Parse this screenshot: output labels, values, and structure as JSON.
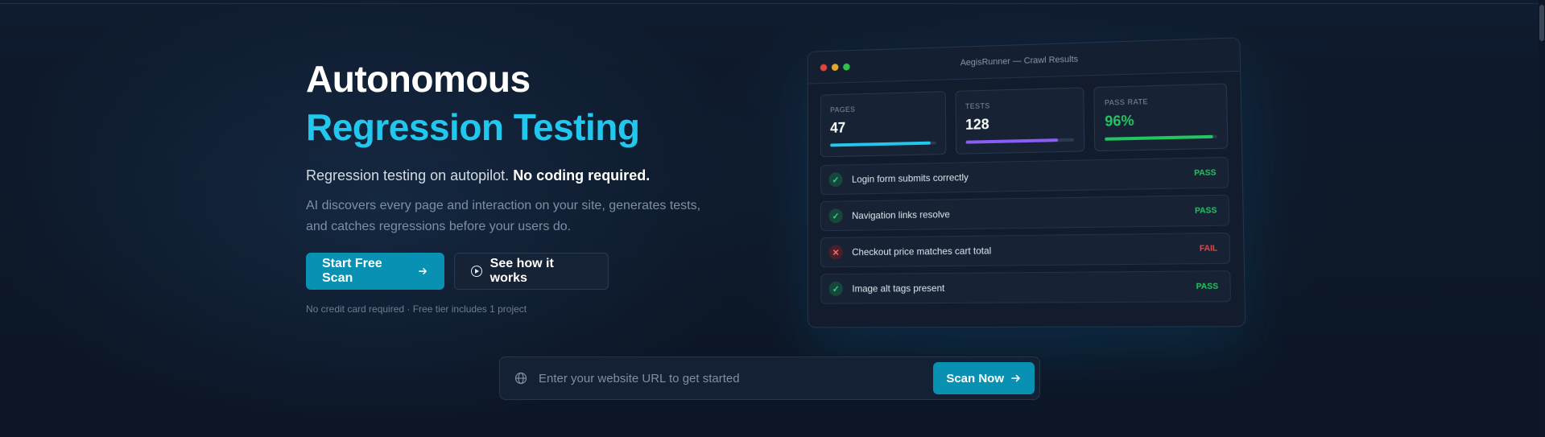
{
  "hero": {
    "headline_line1": "Autonomous",
    "headline_line2": "Regression Testing",
    "tagline_plain": "Regression testing on autopilot.",
    "tagline_bold": "No coding required.",
    "description": "AI discovers every page and interaction on your site, generates tests, and catches regressions before your users do.",
    "primary_cta": "Start Free Scan",
    "secondary_cta": "See how it works",
    "fineprint": "No credit card required · Free tier includes 1 project"
  },
  "app_window": {
    "title": "AegisRunner — Crawl Results",
    "stats": [
      {
        "label": "PAGES",
        "value": "47",
        "fill": 0.95
      },
      {
        "label": "TESTS",
        "value": "128",
        "fill": 0.85
      },
      {
        "label": "PASS RATE",
        "value": "96%",
        "fill": 0.96
      }
    ],
    "tests": [
      {
        "name": "Login form submits correctly",
        "status": "PASS"
      },
      {
        "name": "Navigation links resolve",
        "status": "PASS"
      },
      {
        "name": "Checkout price matches cart total",
        "status": "FAIL"
      },
      {
        "name": "Image alt tags present",
        "status": "PASS"
      }
    ]
  },
  "url_input": {
    "placeholder": "Enter your website URL to get started",
    "value": "",
    "button_label": "Scan Now"
  },
  "colors": {
    "accent": "#22c7ee",
    "button": "#0891b2",
    "pass": "#22c55e",
    "fail": "#ef4444",
    "tests_bar": "#8b5cf6"
  },
  "icons": {
    "arrow": "arrow-right-icon",
    "play": "play-circle-icon",
    "globe": "globe-icon",
    "check": "check-icon",
    "cross": "x-icon"
  }
}
